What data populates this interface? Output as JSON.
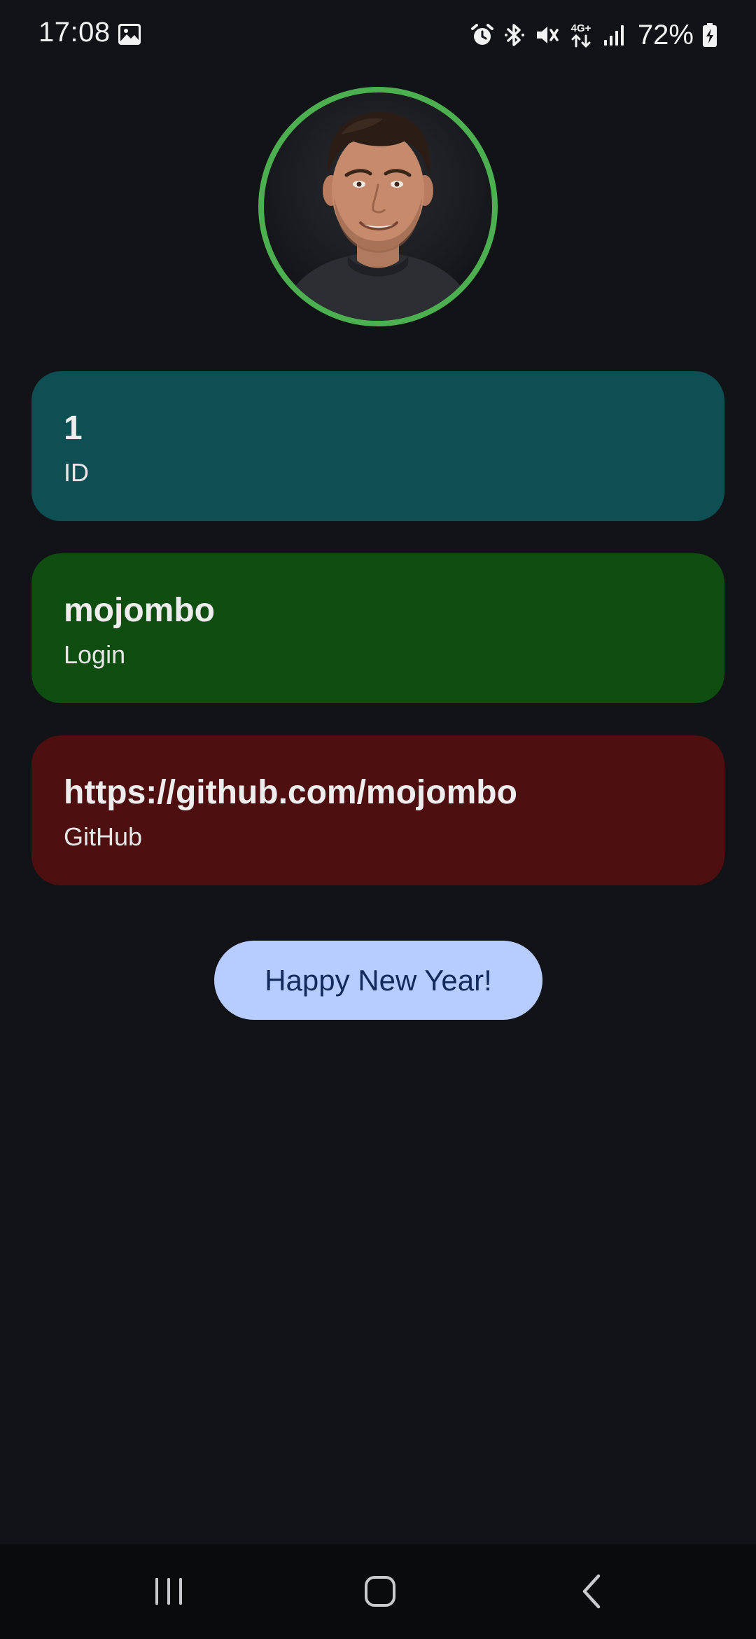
{
  "status_bar": {
    "time": "17:08",
    "battery_percent": "72%",
    "network_type": "4G+",
    "icons": [
      "gallery-icon",
      "alarm-icon",
      "bluetooth-icon",
      "mute-icon",
      "network-4g-icon",
      "signal-icon",
      "battery-charging-icon"
    ]
  },
  "profile": {
    "avatar_icon": "avatar-photo",
    "ring_color": "#4caf50"
  },
  "cards": [
    {
      "value": "1",
      "label": "ID",
      "color": "#0e4f54"
    },
    {
      "value": "mojombo",
      "label": "Login",
      "color": "#0f4d10"
    },
    {
      "value": "https://github.com/mojombo",
      "label": "GitHub",
      "color": "#4e0f10"
    }
  ],
  "action": {
    "button_label": "Happy New Year!",
    "button_color": "#b7ccff"
  },
  "nav_bar": {
    "icons": [
      "recents-icon",
      "home-icon",
      "back-icon"
    ]
  }
}
